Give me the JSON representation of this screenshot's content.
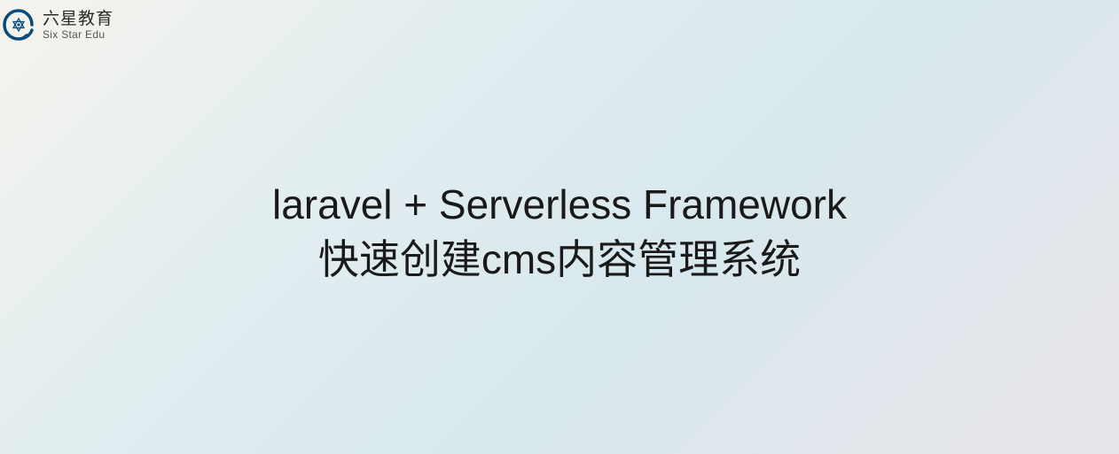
{
  "logo": {
    "cn": "六星教育",
    "en": "Six Star Edu"
  },
  "title": {
    "line1": "laravel + Serverless Framework",
    "line2": "快速创建cms内容管理系统"
  }
}
